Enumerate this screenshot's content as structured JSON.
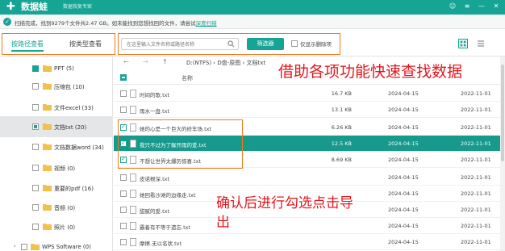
{
  "app": {
    "name": "数据蛙",
    "subtitle": "数据恢复专家"
  },
  "window_buttons": [
    "☺",
    "≡",
    "—",
    "✕"
  ],
  "scan": {
    "status": "扫描完成，找到9279个文件共2.47 GB。如未能找到您想找回的文件，请尝试",
    "link": "深度扫描"
  },
  "toolbar": {
    "tab_path": "按路径查看",
    "tab_type": "按类型查看",
    "search_placeholder": "在这里输入文件名称或路径名称",
    "filter_label": "筛选器",
    "only_deleted": "仅显示删除项"
  },
  "sidebar": {
    "items": [
      {
        "label": "PPT (5)",
        "state": "checked"
      },
      {
        "label": "压缩包 (10)",
        "state": "empty"
      },
      {
        "label": "文件excel (33)",
        "state": "empty"
      },
      {
        "label": "文档txt (20)",
        "state": "partial",
        "active": true
      },
      {
        "label": "文档数据word (34)",
        "state": "empty"
      },
      {
        "label": "视频 (0)",
        "state": "empty"
      },
      {
        "label": "重要的pdf (16)",
        "state": "empty"
      },
      {
        "label": "音频 (0)",
        "state": "empty"
      },
      {
        "label": "照片 (0)",
        "state": "empty"
      },
      {
        "label": "WPS Software (0)",
        "state": "empty",
        "arrow": "›"
      }
    ]
  },
  "main": {
    "nav_back": "←",
    "nav_fwd": "→",
    "nav_up": "↑",
    "path": "D:(NTFS) › D盘-原图 › 文档txt",
    "header_name": "名称",
    "rows": [
      {
        "name": "时间的歌.txt",
        "size": "16.7 KB",
        "date1": "2024-04-15",
        "date2": "2022-11-01",
        "checked": false,
        "selected": false
      },
      {
        "name": "雨水一盘.txt",
        "size": "13.1 KB",
        "date1": "2024-04-15",
        "date2": "2022-11-01",
        "checked": false,
        "selected": false
      },
      {
        "name": "她的心是一个巨大的修车场.txt",
        "size": "6.26 KB",
        "date1": "2024-04-15",
        "date2": "2022-11-01",
        "checked": true,
        "selected": false
      },
      {
        "name": "我只不过为了躲开雨的爱.txt",
        "size": "12.5 KB",
        "date1": "2024-04-15",
        "date2": "2022-11-01",
        "checked": true,
        "selected": true
      },
      {
        "name": "不想让世界太爆历惊喜.txt",
        "size": "8.69 KB",
        "date1": "2024-04-15",
        "date2": "2022-11-01",
        "checked": true,
        "selected": false
      },
      {
        "name": "皮诺根深.txt",
        "size": "",
        "date1": "2024-04-15",
        "date2": "2022-11-01",
        "checked": false,
        "selected": false
      },
      {
        "name": "她回看沙滩的边缘走.txt",
        "size": "",
        "date1": "2024-04-15",
        "date2": "2022-11-01",
        "checked": false,
        "selected": false
      },
      {
        "name": "甜腻的爱.txt",
        "size": "",
        "date1": "2024-04-15",
        "date2": "2022-11-01",
        "checked": false,
        "selected": false
      },
      {
        "name": "霸着有不等于遗忘.txt",
        "size": "",
        "date1": "2024-04-15",
        "date2": "2022-11-01",
        "checked": false,
        "selected": false
      },
      {
        "name": "摩擦.无以名状.txt",
        "size": "",
        "date1": "2024-04-15",
        "date2": "2022-11-01",
        "checked": false,
        "selected": false
      }
    ]
  },
  "overlays": {
    "text1": "借助各项功能快速查找数据",
    "text2": "确认后进行勾选点击导出"
  },
  "colors": {
    "brand": "#16a495",
    "highlight": "#e4161d",
    "annotation_box": "#f07b1f"
  }
}
